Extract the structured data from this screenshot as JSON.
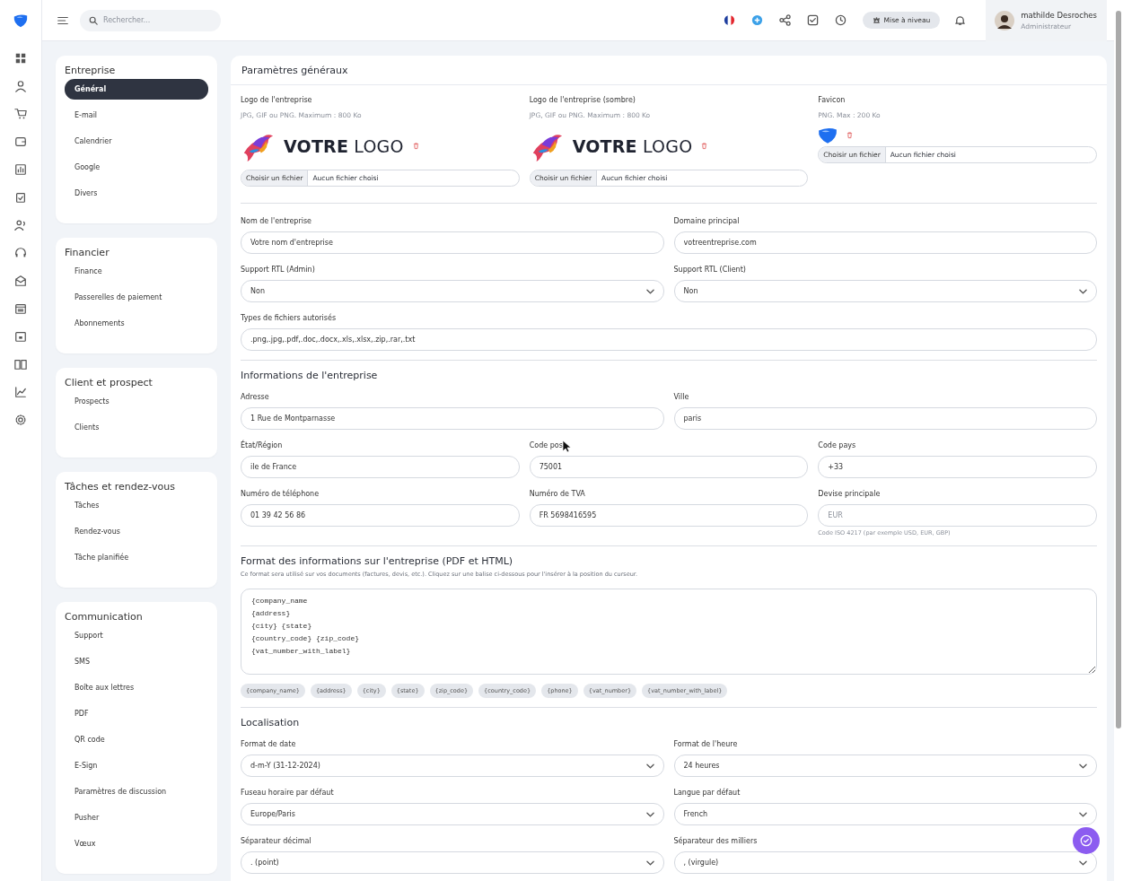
{
  "topbar": {
    "search": {
      "placeholder": "Rechercher..."
    },
    "upgrade": "Mise à niveau",
    "user": {
      "name": "mathilde Desroches",
      "role": "Administrateur"
    }
  },
  "nav": [
    {
      "title": "Entreprise",
      "items": [
        {
          "label": "Général",
          "selected": true
        },
        {
          "label": "E-mail",
          "selected": false
        },
        {
          "label": "Calendrier",
          "selected": false
        },
        {
          "label": "Google",
          "selected": false
        },
        {
          "label": "Divers",
          "selected": false
        }
      ]
    },
    {
      "title": "Financier",
      "items": [
        {
          "label": "Finance",
          "selected": false
        },
        {
          "label": "Passerelles de paiement",
          "selected": false
        },
        {
          "label": "Abonnements",
          "selected": false
        }
      ]
    },
    {
      "title": "Client et prospect",
      "items": [
        {
          "label": "Prospects",
          "selected": false
        },
        {
          "label": "Clients",
          "selected": false
        }
      ]
    },
    {
      "title": "Tâches et rendez-vous",
      "items": [
        {
          "label": "Tâches",
          "selected": false
        },
        {
          "label": "Rendez-vous",
          "selected": false
        },
        {
          "label": "Tâche planifiée",
          "selected": false
        }
      ]
    },
    {
      "title": "Communication",
      "items": [
        {
          "label": "Support",
          "selected": false
        },
        {
          "label": "SMS",
          "selected": false
        },
        {
          "label": "Boîte aux lettres",
          "selected": false
        },
        {
          "label": "PDF",
          "selected": false
        },
        {
          "label": "QR code",
          "selected": false
        },
        {
          "label": "E-Sign",
          "selected": false
        },
        {
          "label": "Paramètres de discussion",
          "selected": false
        },
        {
          "label": "Pusher",
          "selected": false
        },
        {
          "label": "Vœux",
          "selected": false
        }
      ]
    }
  ],
  "main": {
    "title": "Paramètres généraux",
    "uploads": [
      {
        "kind": "logo",
        "label": "Logo de l'entreprise",
        "hint": "JPG, GIF ou PNG. Maximum : 800 Ko",
        "logo_text": "**VOTRE** LOGO",
        "button": "Choisir un fichier",
        "status": "Aucun fichier choisi"
      },
      {
        "kind": "logo",
        "label": "Logo de l'entreprise (sombre)",
        "hint": "JPG, GIF ou PNG. Maximum : 800 Ko",
        "logo_text": "**VOTRE** LOGO",
        "button": "Choisir un fichier",
        "status": "Aucun fichier choisi"
      },
      {
        "kind": "favicon",
        "label": "Favicon",
        "hint": "PNG. Max : 200 Ko",
        "button": "Choisir un fichier",
        "status": "Aucun fichier choisi"
      }
    ],
    "sections": [
      {
        "rows": [
          [
            {
              "kind": "text",
              "label": "Nom de l'entreprise",
              "value": "Votre nom d'entreprise"
            },
            {
              "kind": "text",
              "label": "Domaine principal",
              "value": "votreentreprise.com"
            }
          ],
          [
            {
              "kind": "select",
              "label": "Support RTL (Admin)",
              "value": "Non"
            },
            {
              "kind": "select",
              "label": "Support RTL (Client)",
              "value": "Non"
            }
          ],
          [
            {
              "kind": "text",
              "label": "Types de fichiers autorisés",
              "value": ".png,.jpg,.pdf,.doc,.docx,.xls,.xlsx,.zip,.rar,.txt"
            }
          ]
        ]
      },
      {
        "title": "Informations de l'entreprise",
        "rows": [
          [
            {
              "kind": "text",
              "label": "Adresse",
              "value": "1 Rue de Montparnasse"
            },
            {
              "kind": "text",
              "label": "Ville",
              "value": "paris"
            }
          ],
          [
            {
              "kind": "text",
              "label": "État/Région",
              "value": "ile de France"
            },
            {
              "kind": "text",
              "label": "Code pos",
              "value": "75001",
              "cursor": true
            },
            {
              "kind": "text",
              "label": "Code pays",
              "value": "+33"
            }
          ],
          [
            {
              "kind": "text",
              "label": "Numéro de téléphone",
              "value": "01 39 42 56 86"
            },
            {
              "kind": "text",
              "label": "Numéro de TVA",
              "value": "FR 5698416595"
            },
            {
              "kind": "text",
              "label": "Devise principale",
              "placeholder": "EUR",
              "help": "Code ISO 4217 (par exemple USD, EUR, GBP)"
            }
          ]
        ]
      },
      {
        "title": "Format des informations sur l'entreprise (PDF et HTML)",
        "description": "Ce format sera utilisé sur vos documents (factures, devis, etc.). Cliquez sur une balise ci-dessous pour l'insérer à la position du curseur.",
        "rows": [
          [
            {
              "kind": "textarea",
              "value": "{company_name\n{address}\n{city} {state}\n{country_code} {zip_code}\n{vat_number_with_label}"
            }
          ],
          [
            {
              "kind": "tags",
              "tags": [
                "{company_name}",
                "{address}",
                "{city}",
                "{state}",
                "{zip_code}",
                "{country_code}",
                "{phone}",
                "{vat_number}",
                "{vat_number_with_label}"
              ]
            }
          ]
        ]
      },
      {
        "title": "Localisation",
        "rows": [
          [
            {
              "kind": "select",
              "label": "Format de date",
              "value": "d-m-Y (31-12-2024)"
            },
            {
              "kind": "select",
              "label": "Format de l'heure",
              "value": "24 heures"
            }
          ],
          [
            {
              "kind": "select",
              "label": "Fuseau horaire par défaut",
              "value": "Europe/Paris"
            },
            {
              "kind": "select",
              "label": "Langue par défaut",
              "value": "French"
            }
          ],
          [
            {
              "kind": "select",
              "label": "Séparateur décimal",
              "value": ". (point)"
            },
            {
              "kind": "select",
              "label": "Séparateur des milliers",
              "value": ", (virgule)"
            }
          ]
        ]
      }
    ]
  }
}
